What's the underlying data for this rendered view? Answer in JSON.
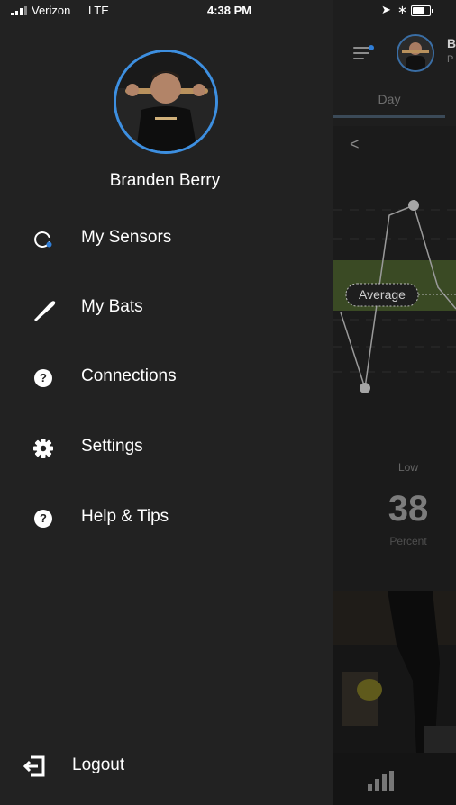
{
  "status_bar": {
    "carrier": "Verizon",
    "network": "LTE",
    "time": "4:38 PM"
  },
  "drawer": {
    "user_name": "Branden Berry",
    "menu": [
      {
        "label": "My Sensors",
        "icon": "sensor-ring-icon"
      },
      {
        "label": "My Bats",
        "icon": "bat-icon"
      },
      {
        "label": "Connections",
        "icon": "help-circle-icon"
      },
      {
        "label": "Settings",
        "icon": "gear-icon"
      },
      {
        "label": "Help & Tips",
        "icon": "help-circle-icon"
      }
    ],
    "logout_label": "Logout",
    "colors": {
      "background": "#222222",
      "accent": "#3d8fe0"
    }
  },
  "app": {
    "header_initial": "B",
    "header_sub": "P",
    "tab_label": "Day",
    "back_glyph": "<",
    "average_label": "Average",
    "metric_label": "Low",
    "metric_value": "38",
    "metric_unit": "Percent"
  }
}
